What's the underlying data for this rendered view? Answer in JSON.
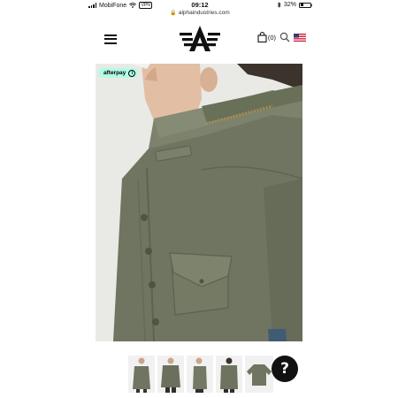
{
  "status_bar": {
    "carrier": "MobiFone",
    "vpn": "VPN",
    "time": "09:12",
    "battery": "32%",
    "battery_level": 0.32,
    "icons": [
      "signal-icon",
      "wifi-icon",
      "bluetooth-icon",
      "battery-icon"
    ]
  },
  "browser": {
    "url": "alphaindustries.com",
    "lock_icon": "lock-icon"
  },
  "header": {
    "menu_icon": "hamburger-menu-icon",
    "logo": "alpha-industries-logo",
    "cart_count": "(0)",
    "cart_icon": "shopping-bag-icon",
    "search_icon": "search-icon",
    "flag_icon": "us-flag-icon"
  },
  "product": {
    "afterpay_label": "afterpay",
    "afterpay_info": "i",
    "jacket_color": "#6f7560",
    "afterpay_color": "#b2fce4",
    "thumbnail_count": 5
  },
  "help_button": {
    "label": "?"
  }
}
